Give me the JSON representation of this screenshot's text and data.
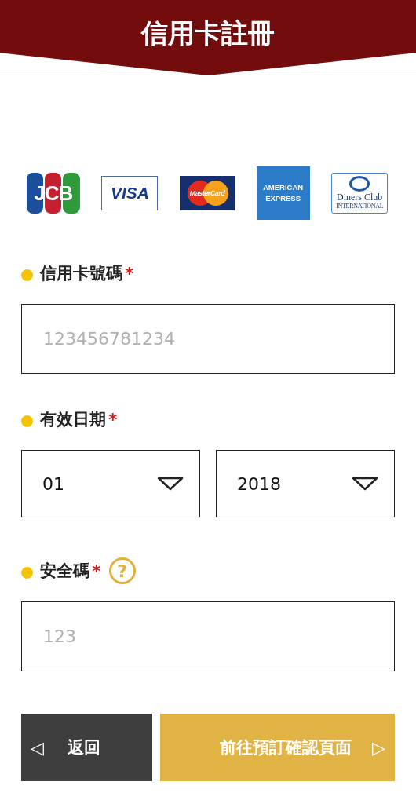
{
  "header": {
    "title": "信用卡註冊"
  },
  "card_logos": [
    {
      "kind": "jcb",
      "lines": [
        "JCB"
      ]
    },
    {
      "kind": "visa",
      "lines": [
        "VISA"
      ]
    },
    {
      "kind": "mastercard",
      "lines": [
        "MasterCard"
      ]
    },
    {
      "kind": "amex",
      "lines": [
        "AMERICAN",
        "EXPRESS"
      ]
    },
    {
      "kind": "diners",
      "lines": [
        "Diners Club",
        "INTERNATIONAL"
      ]
    }
  ],
  "fields": [
    {
      "kind": "text",
      "label": "信用卡號碼",
      "required_mark": "*",
      "help": false,
      "placeholder": "123456781234"
    },
    {
      "kind": "selects",
      "label": "有效日期",
      "required_mark": "*",
      "help": false,
      "values": [
        "01",
        "2018"
      ]
    },
    {
      "kind": "text",
      "label": "安全碼",
      "required_mark": "*",
      "help": true,
      "help_glyph": "?",
      "placeholder": "123"
    }
  ],
  "buttons": {
    "back": {
      "label": "返回",
      "glyph": "◁"
    },
    "next": {
      "label": "前往預訂確認頁面",
      "glyph": "▷"
    }
  }
}
